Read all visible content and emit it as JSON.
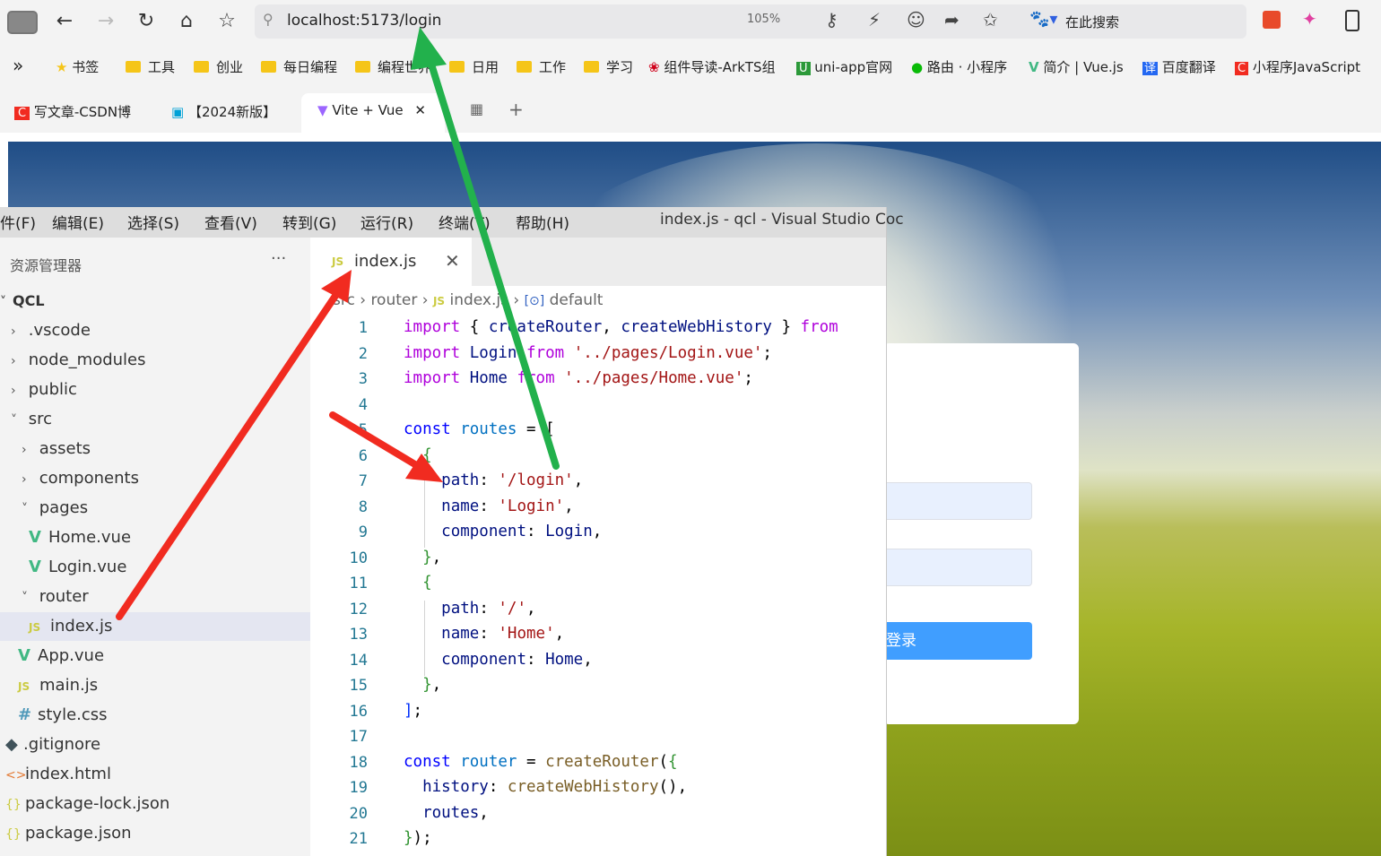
{
  "browser": {
    "url": "localhost:5173/login",
    "zoom": "105%",
    "search_placeholder": "在此搜索",
    "bookmarks": [
      "书签",
      "工具",
      "创业",
      "每日编程",
      "编程世界",
      "日用",
      "工作",
      "学习",
      "组件导读-ArkTS组",
      "uni-app官网",
      "路由 · 小程序",
      "简介 | Vue.js",
      "百度翻译",
      "小程序JavaScript"
    ],
    "tabs": [
      "写文章-CSDN博",
      "【2024新版】",
      "Vite + Vue"
    ]
  },
  "login": {
    "button_label": "登录"
  },
  "vscode": {
    "menus": [
      "件(F)",
      "编辑(E)",
      "选择(S)",
      "查看(V)",
      "转到(G)",
      "运行(R)",
      "终端(T)",
      "帮助(H)"
    ],
    "window_title": "index.js - qcl - Visual Studio Coc",
    "explorer_title": "资源管理器",
    "root": "QCL",
    "tree": [
      ".vscode",
      "node_modules",
      "public",
      "src",
      "assets",
      "components",
      "pages",
      "Home.vue",
      "Login.vue",
      "router",
      "index.js",
      "App.vue",
      "main.js",
      "style.css",
      ".gitignore",
      "index.html",
      "package-lock.json",
      "package.json"
    ],
    "tab": "index.js",
    "breadcrumb": [
      "src",
      "router",
      "index.js",
      "default"
    ],
    "line_numbers": [
      "1",
      "2",
      "3",
      "4",
      "5",
      "6",
      "7",
      "8",
      "9",
      "10",
      "11",
      "12",
      "13",
      "14",
      "15",
      "16",
      "17",
      "18",
      "19",
      "20",
      "21"
    ]
  },
  "annotations": {
    "colors": {
      "green": "#22b14c",
      "red": "#f12b20"
    }
  }
}
